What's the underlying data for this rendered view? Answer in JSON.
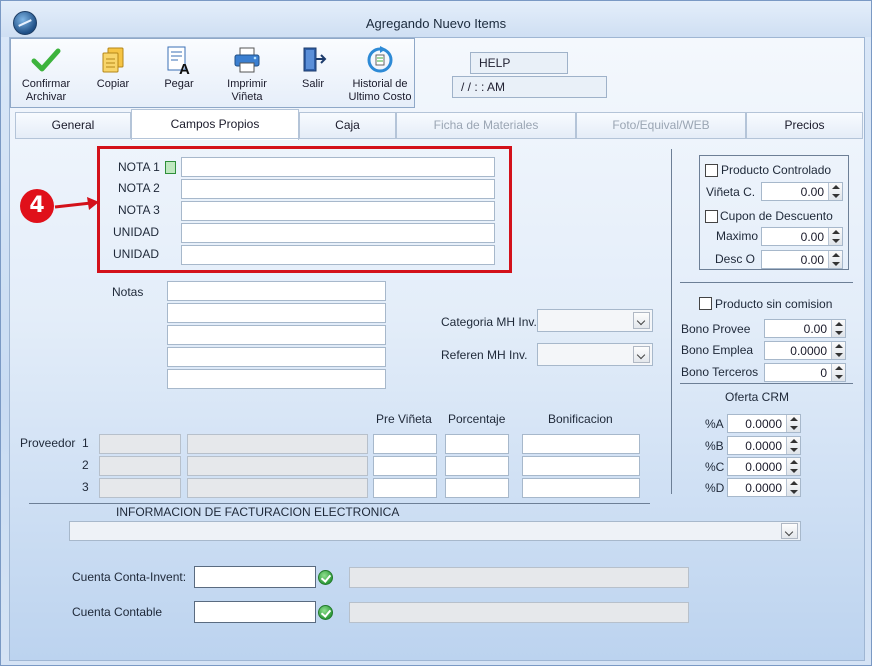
{
  "window": {
    "title": "Agregando Nuevo Items"
  },
  "toolbar": {
    "buttons": [
      {
        "label1": "Confirmar",
        "label2": "Archivar"
      },
      {
        "label1": "Copiar",
        "label2": ""
      },
      {
        "label1": "Pegar",
        "label2": ""
      },
      {
        "label1": "Imprimir",
        "label2": "Viñeta"
      },
      {
        "label1": "Salir",
        "label2": ""
      },
      {
        "label1": "Historial de",
        "label2": "Ultimo Costo"
      }
    ]
  },
  "help": {
    "label": "HELP",
    "datetime": "/ /       : :   AM"
  },
  "tabs": [
    {
      "label": "General",
      "state": "normal"
    },
    {
      "label": "Campos Propios",
      "state": "active"
    },
    {
      "label": "Caja",
      "state": "normal"
    },
    {
      "label": "Ficha de Materiales",
      "state": "disabled"
    },
    {
      "label": "Foto/Equival/WEB",
      "state": "disabled"
    },
    {
      "label": "Precios",
      "state": "normal"
    }
  ],
  "annotation": {
    "number": "4"
  },
  "campos": {
    "labels": [
      "NOTA 1",
      "NOTA 2",
      "NOTA 3",
      "UNIDAD",
      "UNIDAD"
    ],
    "notas_label": "Notas"
  },
  "categoria": {
    "label": "Categoria MH Inv.",
    "value": ""
  },
  "referen": {
    "label": "Referen MH Inv.",
    "value": ""
  },
  "proveedor": {
    "label": "Proveedor",
    "rows": [
      "1",
      "2",
      "3"
    ],
    "col_headers": [
      "Pre Viñeta",
      "Porcentaje",
      "Bonificacion"
    ]
  },
  "factura": {
    "label": "INFORMACION DE FACTURACION ELECTRONICA",
    "value": ""
  },
  "cuentas": {
    "conta_invent_label": "Cuenta Conta-Invent:",
    "contable_label": "Cuenta Contable"
  },
  "right": {
    "producto_controlado": "Producto Controlado",
    "vineta_c_label": "Viñeta C.",
    "vineta_c_value": "0.00",
    "cupon_descuento": "Cupon de Descuento",
    "maximo_label": "Maximo",
    "maximo_value": "0.00",
    "desco_label": "Desc O",
    "desco_value": "0.00",
    "sin_comision": "Producto sin comision",
    "bono_provee_label": "Bono Provee",
    "bono_provee_value": "0.00",
    "bono_emplea_label": "Bono Emplea",
    "bono_emplea_value": "0.0000",
    "bono_terceros_label": "Bono Terceros",
    "bono_terceros_value": "0",
    "oferta_label": "Oferta CRM",
    "oferta": [
      {
        "label": "%A",
        "value": "0.0000"
      },
      {
        "label": "%B",
        "value": "0.0000"
      },
      {
        "label": "%C",
        "value": "0.0000"
      },
      {
        "label": "%D",
        "value": "0.0000"
      }
    ]
  }
}
